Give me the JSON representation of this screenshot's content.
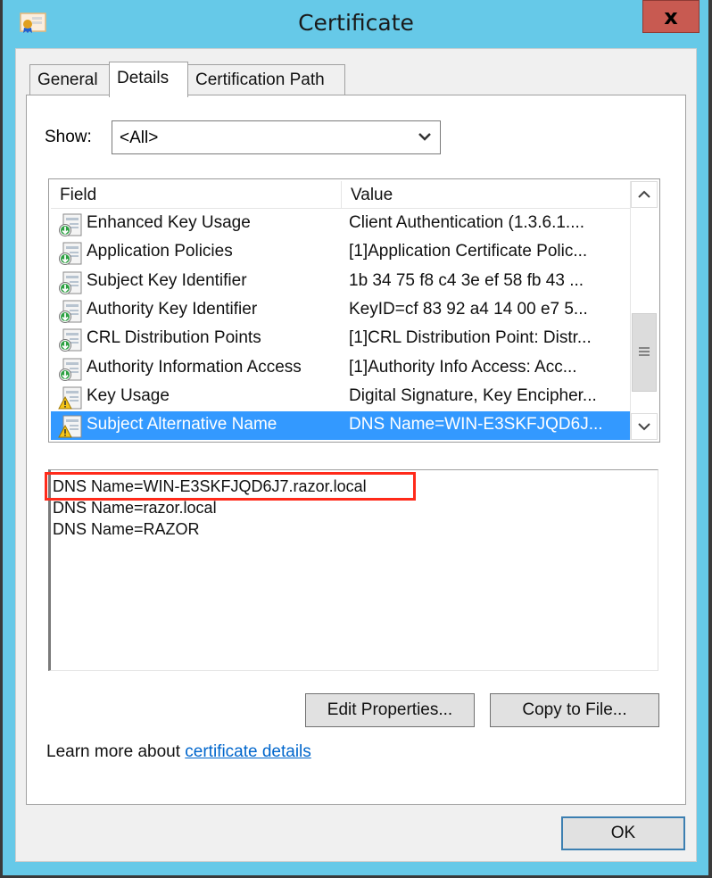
{
  "window": {
    "title": "Certificate",
    "close_label": "x"
  },
  "tabs": [
    {
      "label": "General",
      "active": false
    },
    {
      "label": "Details",
      "active": true
    },
    {
      "label": "Certification Path",
      "active": false
    }
  ],
  "show": {
    "label": "Show:",
    "selected": "<All>"
  },
  "list": {
    "columns": [
      "Field",
      "Value"
    ],
    "rows": [
      {
        "field": "Enhanced Key Usage",
        "value": "Client Authentication (1.3.6.1....",
        "icon": "extension-icon"
      },
      {
        "field": "Application Policies",
        "value": "[1]Application Certificate Polic...",
        "icon": "extension-icon"
      },
      {
        "field": "Subject Key Identifier",
        "value": "1b 34 75 f8 c4 3e ef 58 fb 43 ...",
        "icon": "extension-icon"
      },
      {
        "field": "Authority Key Identifier",
        "value": "KeyID=cf 83 92 a4 14 00 e7 5...",
        "icon": "extension-icon"
      },
      {
        "field": "CRL Distribution Points",
        "value": "[1]CRL Distribution Point: Distr...",
        "icon": "extension-icon"
      },
      {
        "field": "Authority Information Access",
        "value": "[1]Authority Info Access: Acc...",
        "icon": "extension-icon"
      },
      {
        "field": "Key Usage",
        "value": "Digital Signature, Key Encipher...",
        "icon": "critical-extension-icon"
      },
      {
        "field": "Subject Alternative Name",
        "value": "DNS Name=WIN-E3SKFJQD6J...",
        "icon": "critical-extension-icon",
        "selected": true
      }
    ]
  },
  "details": {
    "lines": [
      "DNS Name=WIN-E3SKFJQD6J7.razor.local",
      "DNS Name=razor.local",
      "DNS Name=RAZOR"
    ]
  },
  "buttons": {
    "edit_properties": "Edit Properties...",
    "copy_to_file": "Copy to File...",
    "ok": "OK"
  },
  "learn_more": {
    "prefix": "Learn more about ",
    "link": "certificate details"
  },
  "colors": {
    "title_bar": "#66c9e8",
    "close_button": "#c85a51",
    "selection": "#3399ff",
    "highlight_annotation": "#ff2a1a",
    "link": "#0066cc"
  }
}
